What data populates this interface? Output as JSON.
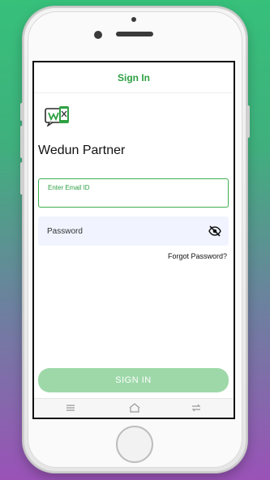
{
  "app": {
    "title": "Sign In",
    "brand_name": "Wedun Partner"
  },
  "form": {
    "email_label": "Enter Email ID",
    "email_value": "",
    "password_placeholder": "Password",
    "forgot_password": "Forgot Password?",
    "submit_label": "SIGN IN"
  },
  "navbar": {
    "icons": [
      "menu-icon",
      "home-icon",
      "back-icon"
    ]
  },
  "colors": {
    "accent": "#2ea043",
    "button_disabled": "#9ed8a9",
    "password_bg": "#f1f4ff"
  }
}
